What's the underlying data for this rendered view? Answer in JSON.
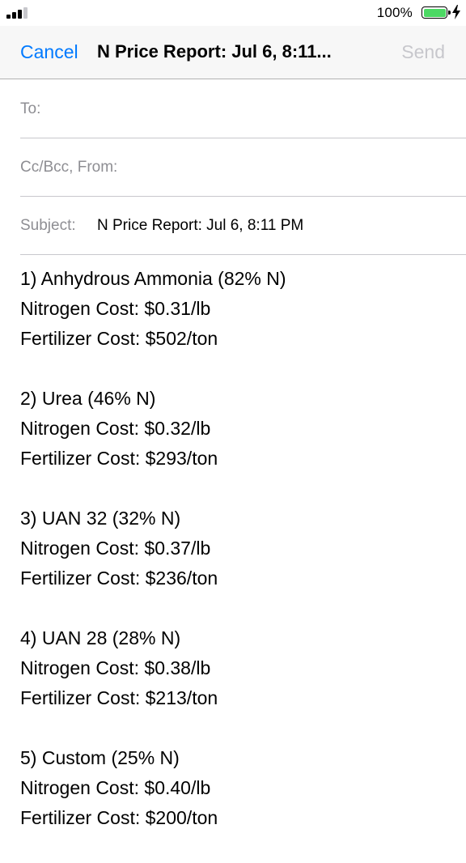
{
  "status_bar": {
    "battery_percent": "100%",
    "battery_level": 1.0,
    "signal_bars_filled": 3,
    "signal_bars_total": 4,
    "charging": true,
    "battery_color": "#4cd964",
    "signal_icon": "cellular-signal-icon",
    "battery_icon": "battery-icon",
    "bolt_icon": "charging-bolt-icon"
  },
  "nav": {
    "cancel_label": "Cancel",
    "title": "N Price Report: Jul 6, 8:11...",
    "send_label": "Send",
    "accent_color": "#007aff",
    "disabled_color": "#c7c7cc"
  },
  "fields": {
    "to_label": "To:",
    "ccbcc_label": "Cc/Bcc, From:",
    "subject_label": "Subject:",
    "subject_value": "N Price Report: Jul 6, 8:11 PM"
  },
  "report": [
    {
      "name": "1) Anhydrous Ammonia (82% N)",
      "nitrogen_cost": "Nitrogen Cost: $0.31/lb",
      "fertilizer_cost": "Fertilizer Cost: $502/ton"
    },
    {
      "name": "2) Urea (46% N)",
      "nitrogen_cost": "Nitrogen Cost: $0.32/lb",
      "fertilizer_cost": "Fertilizer Cost: $293/ton"
    },
    {
      "name": "3) UAN 32 (32% N)",
      "nitrogen_cost": "Nitrogen Cost: $0.37/lb",
      "fertilizer_cost": "Fertilizer Cost: $236/ton"
    },
    {
      "name": "4) UAN 28 (28% N)",
      "nitrogen_cost": "Nitrogen Cost: $0.38/lb",
      "fertilizer_cost": "Fertilizer Cost: $213/ton"
    },
    {
      "name": "5) Custom (25% N)",
      "nitrogen_cost": "Nitrogen Cost: $0.40/lb",
      "fertilizer_cost": "Fertilizer Cost: $200/ton"
    }
  ]
}
